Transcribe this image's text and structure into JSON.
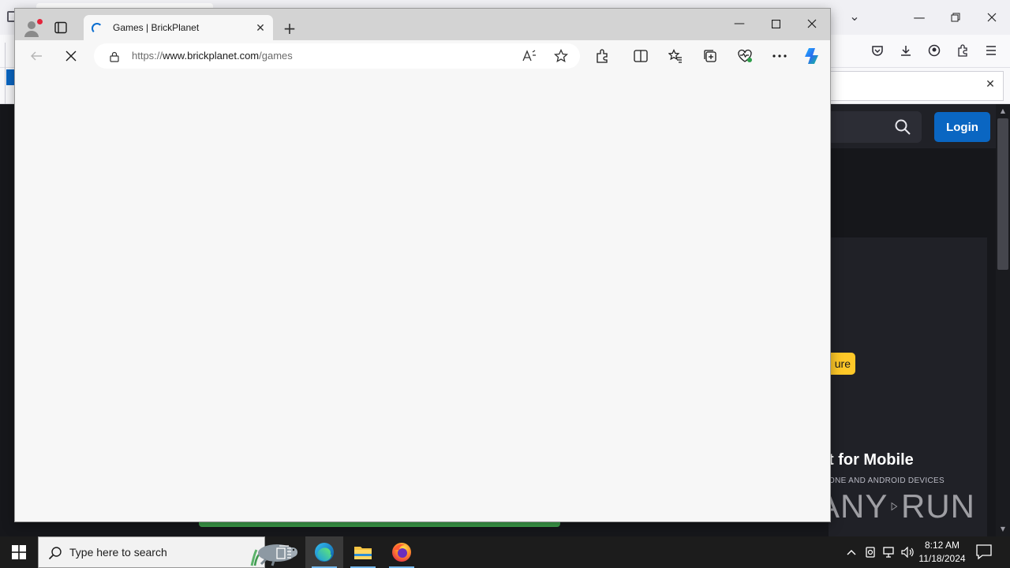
{
  "background_browser": {
    "login_label": "Login",
    "promo_badge_fragment": "ure",
    "mobile_title_fragment": "t for Mobile",
    "mobile_subtitle_fragment": "ONE AND ANDROID DEVICES"
  },
  "edge": {
    "tab_title": "Games | BrickPlanet",
    "url_scheme": "https://",
    "url_host": "www.brickplanet.com",
    "url_path": "/games"
  },
  "watermark": {
    "left": "ANY",
    "right": "RUN"
  },
  "taskbar": {
    "search_placeholder": "Type here to search",
    "time": "8:12 AM",
    "date": "11/18/2024"
  },
  "colors": {
    "login_blue": "#0a66c2",
    "promo_yellow": "#fec828",
    "site_dark": "#16171b",
    "edge_titlebar": "#d3d3d3",
    "taskbar": "#1c1c1c"
  }
}
